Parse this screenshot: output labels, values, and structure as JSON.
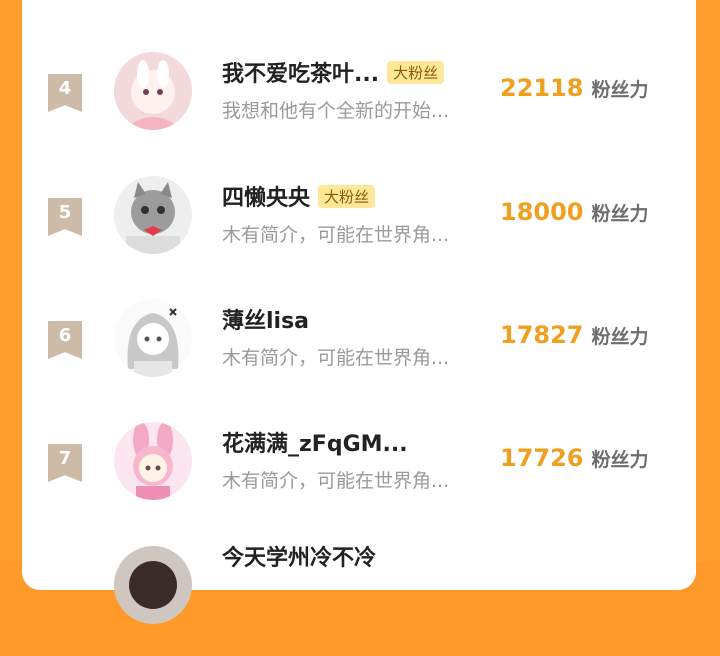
{
  "list": {
    "rows": [
      {
        "rank": "4",
        "name": "我不爱吃茶叶...",
        "badge": "大粉丝",
        "bio": "我想和他有个全新的开始...",
        "score": "22118",
        "unit": "粉丝力"
      },
      {
        "rank": "5",
        "name": "四懒央央",
        "badge": "大粉丝",
        "bio": "木有简介，可能在世界角...",
        "score": "18000",
        "unit": "粉丝力"
      },
      {
        "rank": "6",
        "name": "薄丝lisa",
        "badge": "",
        "bio": "木有简介，可能在世界角...",
        "score": "17827",
        "unit": "粉丝力"
      },
      {
        "rank": "7",
        "name": "花满满_zFqGM...",
        "badge": "",
        "bio": "木有简介，可能在世界角...",
        "score": "17726",
        "unit": "粉丝力"
      },
      {
        "rank": "",
        "name": "今天学州冷不冷",
        "badge": "",
        "bio": "",
        "score": "",
        "unit": ""
      }
    ]
  },
  "colors": {
    "accent": "#f0a020",
    "background": "#ff9a2a",
    "badge_bg": "#ffe79a",
    "rank_flag": "#cdbba8"
  }
}
